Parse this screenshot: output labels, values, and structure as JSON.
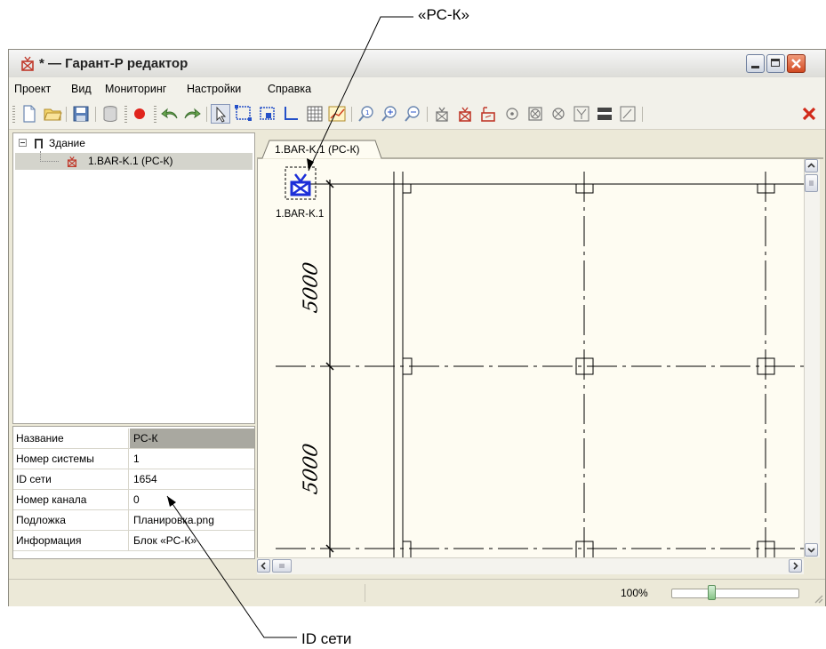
{
  "callouts": {
    "top": "«РС-К»",
    "bottom": "ID сети"
  },
  "window": {
    "title": "* — Гарант-Р редактор"
  },
  "menu": [
    "Проект",
    "Вид",
    "Мониторинг",
    "Настройки",
    "Справка"
  ],
  "toolbar_icons": [
    "new-file-icon",
    "open-folder-icon",
    "save-icon",
    "database-icon",
    "record-icon",
    "undo-icon",
    "redo-icon",
    "pointer-icon",
    "select-area-icon",
    "add-group-icon",
    "corner-icon",
    "grid-icon",
    "chart-icon",
    "zoom-1-icon",
    "zoom-in-icon",
    "zoom-out-icon",
    "sensor-icon",
    "sensor-red-icon",
    "sensor-box-icon",
    "circle-dot-icon",
    "square-x-icon",
    "circle-x-icon",
    "funnel-icon",
    "bar-icon",
    "rect-pen-icon",
    "delete-icon"
  ],
  "tree": {
    "root": "Здание",
    "child": "1.BAR-K.1 (РС-К)"
  },
  "properties": [
    {
      "name": "Название",
      "value": "РС-К"
    },
    {
      "name": "Номер системы",
      "value": "1"
    },
    {
      "name": "ID сети",
      "value": "1654"
    },
    {
      "name": "Номер канала",
      "value": "0"
    },
    {
      "name": "Подложка",
      "value": "Планировка.png"
    },
    {
      "name": "Информация",
      "value": "Блок «РС-К»"
    }
  ],
  "tab": {
    "label": "1.BAR-K.1 (РС-К)"
  },
  "canvas": {
    "device_label": "1.BAR-K.1",
    "dimension_labels": [
      "5000",
      "5000"
    ]
  },
  "status": {
    "zoom": "100%",
    "zoom_level": 0.3
  }
}
